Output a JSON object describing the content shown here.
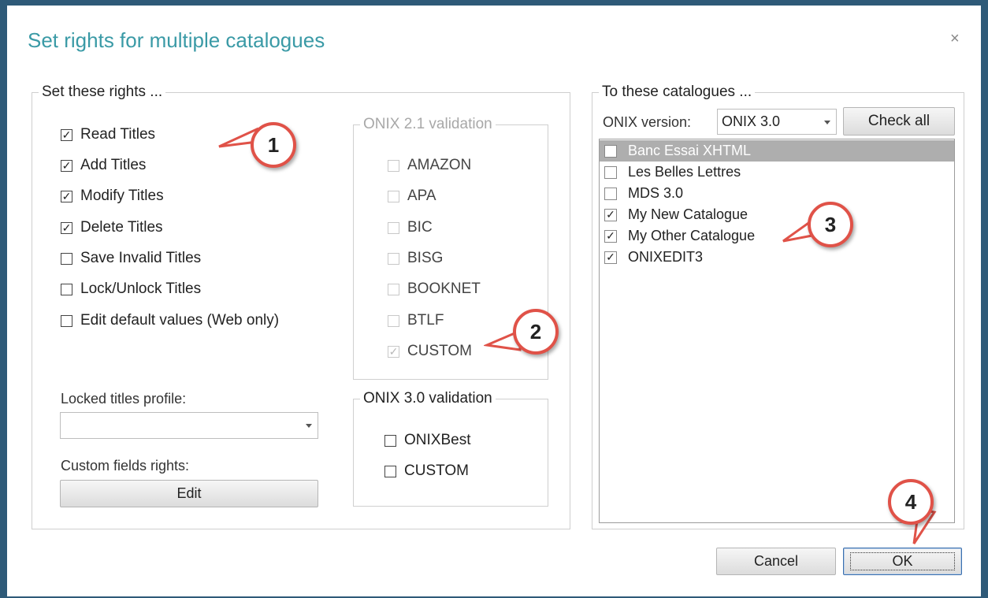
{
  "dialog": {
    "title": "Set rights for multiple catalogues",
    "close_glyph": "×"
  },
  "rights": {
    "legend": "Set these rights ...",
    "items": [
      {
        "label": "Read Titles",
        "checked": true
      },
      {
        "label": "Add Titles",
        "checked": true
      },
      {
        "label": "Modify Titles",
        "checked": true
      },
      {
        "label": "Delete Titles",
        "checked": true
      },
      {
        "label": "Save Invalid Titles",
        "checked": false
      },
      {
        "label": "Lock/Unlock Titles",
        "checked": false
      },
      {
        "label": "Edit default values (Web only)",
        "checked": false
      }
    ],
    "locked_profile_label": "Locked titles profile:",
    "locked_profile_value": "",
    "custom_fields_label": "Custom fields rights:",
    "edit_button": "Edit"
  },
  "onix21": {
    "legend": "ONIX 2.1 validation",
    "items": [
      {
        "label": "AMAZON",
        "checked": false
      },
      {
        "label": "APA",
        "checked": false
      },
      {
        "label": "BIC",
        "checked": false
      },
      {
        "label": "BISG",
        "checked": false
      },
      {
        "label": "BOOKNET",
        "checked": false
      },
      {
        "label": "BTLF",
        "checked": false
      },
      {
        "label": "CUSTOM",
        "checked": true
      }
    ]
  },
  "onix30": {
    "legend": "ONIX 3.0 validation",
    "items": [
      {
        "label": "ONIXBest",
        "checked": false
      },
      {
        "label": "CUSTOM",
        "checked": false
      }
    ]
  },
  "catalogues": {
    "legend": "To these catalogues ...",
    "version_label": "ONIX version:",
    "version_value": "ONIX 3.0",
    "check_all_button": "Check all",
    "items": [
      {
        "label": "Banc Essai XHTML",
        "checked": false,
        "selected": true
      },
      {
        "label": "Les Belles Lettres",
        "checked": false,
        "selected": false
      },
      {
        "label": "MDS 3.0",
        "checked": false,
        "selected": false
      },
      {
        "label": "My New Catalogue",
        "checked": true,
        "selected": false
      },
      {
        "label": "My Other Catalogue",
        "checked": true,
        "selected": false
      },
      {
        "label": "ONIXEDIT3",
        "checked": true,
        "selected": false
      }
    ]
  },
  "footer": {
    "cancel_button": "Cancel",
    "ok_button": "OK"
  },
  "callouts": [
    "1",
    "2",
    "3",
    "4"
  ],
  "colors": {
    "title": "#3a9aa6",
    "window_border": "#2e5a78",
    "callout_border": "#e05248",
    "selected_row": "#aeaeae"
  }
}
